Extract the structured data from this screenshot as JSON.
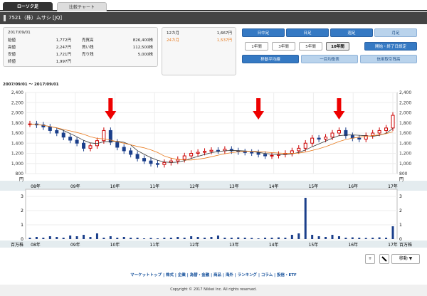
{
  "tabs": [
    {
      "label": "ローソク足"
    },
    {
      "label": "比較チャート"
    }
  ],
  "stock_title": "7521（株）ムサシ [JQ]",
  "price_info": {
    "date": "2017/09/01",
    "rows": [
      {
        "label": "始値",
        "value": "1,772円",
        "label2": "売買高",
        "value2": "826,400株"
      },
      {
        "label": "高値",
        "value": "2,247円",
        "label2": "買い残",
        "value2": "112,500株"
      },
      {
        "label": "安値",
        "value": "1,721円",
        "label2": "売り残",
        "value2": "5,000株"
      },
      {
        "label": "終値",
        "value": "1,997円",
        "label2": "",
        "value2": ""
      }
    ]
  },
  "ma_info": {
    "rows": [
      {
        "label": "12カ月",
        "value": "1,667円",
        "color": "#333333"
      },
      {
        "label": "24カ月",
        "value": "1,537円",
        "color": "#e8791c"
      }
    ]
  },
  "period_buttons": [
    {
      "label": "日中足"
    },
    {
      "label": "日足"
    },
    {
      "label": "週足"
    },
    {
      "label": "月足"
    }
  ],
  "range_buttons": [
    {
      "label": "1年間"
    },
    {
      "label": "3年間"
    },
    {
      "label": "5年間"
    },
    {
      "label": "10年間"
    }
  ],
  "date_set_button": "開始・終了日設定",
  "indicator_buttons": [
    {
      "label": "移動平均線"
    },
    {
      "label": "一目均衡表"
    },
    {
      "label": "信用取引残高"
    }
  ],
  "date_range": "2007/09/01 〜 2017/09/01",
  "chart_data": {
    "type": "candlestick",
    "x_tick_labels": [
      "08年",
      "09年",
      "10年",
      "11年",
      "12年",
      "13年",
      "14年",
      "15年",
      "16年",
      "17年"
    ],
    "price_axis": {
      "ticks": [
        "2,400",
        "2,200",
        "2,000",
        "1,800",
        "1,600",
        "1,400",
        "1,200",
        "1,000",
        "800"
      ],
      "unit": "円",
      "ylim": [
        800,
        2400
      ]
    },
    "volume_axis": {
      "ticks": [
        "3",
        "2",
        "1",
        "0"
      ],
      "unit": "百万株",
      "ylim": [
        0,
        3.2
      ]
    },
    "close_approx": [
      1780,
      1760,
      1720,
      1650,
      1600,
      1520,
      1460,
      1400,
      1300,
      1350,
      1450,
      1650,
      1420,
      1320,
      1250,
      1180,
      1100,
      1050,
      1000,
      980,
      1020,
      1050,
      1080,
      1150,
      1200,
      1220,
      1240,
      1260,
      1250,
      1280,
      1250,
      1230,
      1220,
      1210,
      1180,
      1150,
      1160,
      1180,
      1200,
      1250,
      1300,
      1400,
      1500,
      1480,
      1520,
      1600,
      1650,
      1550,
      1500,
      1480,
      1550,
      1600,
      1650,
      1700,
      1950
    ],
    "volume_approx": [
      0.1,
      0.15,
      0.1,
      0.2,
      0.15,
      0.1,
      0.25,
      0.2,
      0.3,
      0.15,
      0.4,
      0.1,
      0.2,
      0.1,
      0.15,
      0.1,
      0.1,
      0.05,
      0.08,
      0.05,
      0.1,
      0.1,
      0.15,
      0.1,
      0.2,
      0.15,
      0.1,
      0.15,
      0.25,
      0.1,
      0.1,
      0.12,
      0.1,
      0.08,
      0.05,
      0.1,
      0.1,
      0.12,
      0.1,
      0.3,
      0.4,
      2.9,
      0.3,
      0.2,
      0.15,
      0.3,
      0.2,
      0.1,
      0.12,
      0.1,
      0.08,
      0.1,
      0.12,
      0.1,
      0.9
    ],
    "arrows_at_index": [
      12,
      34,
      46
    ]
  },
  "chart_controls": {
    "plus": "+",
    "move": "移動"
  },
  "footer_links": "マーケットトップ | 株式 | 企業 | 為替・金融 | 商品 | 海外 | ランキング | コラム | 投信・ETF",
  "copyright": "Copyright © 2017 Nikkei Inc. All rights reserved."
}
